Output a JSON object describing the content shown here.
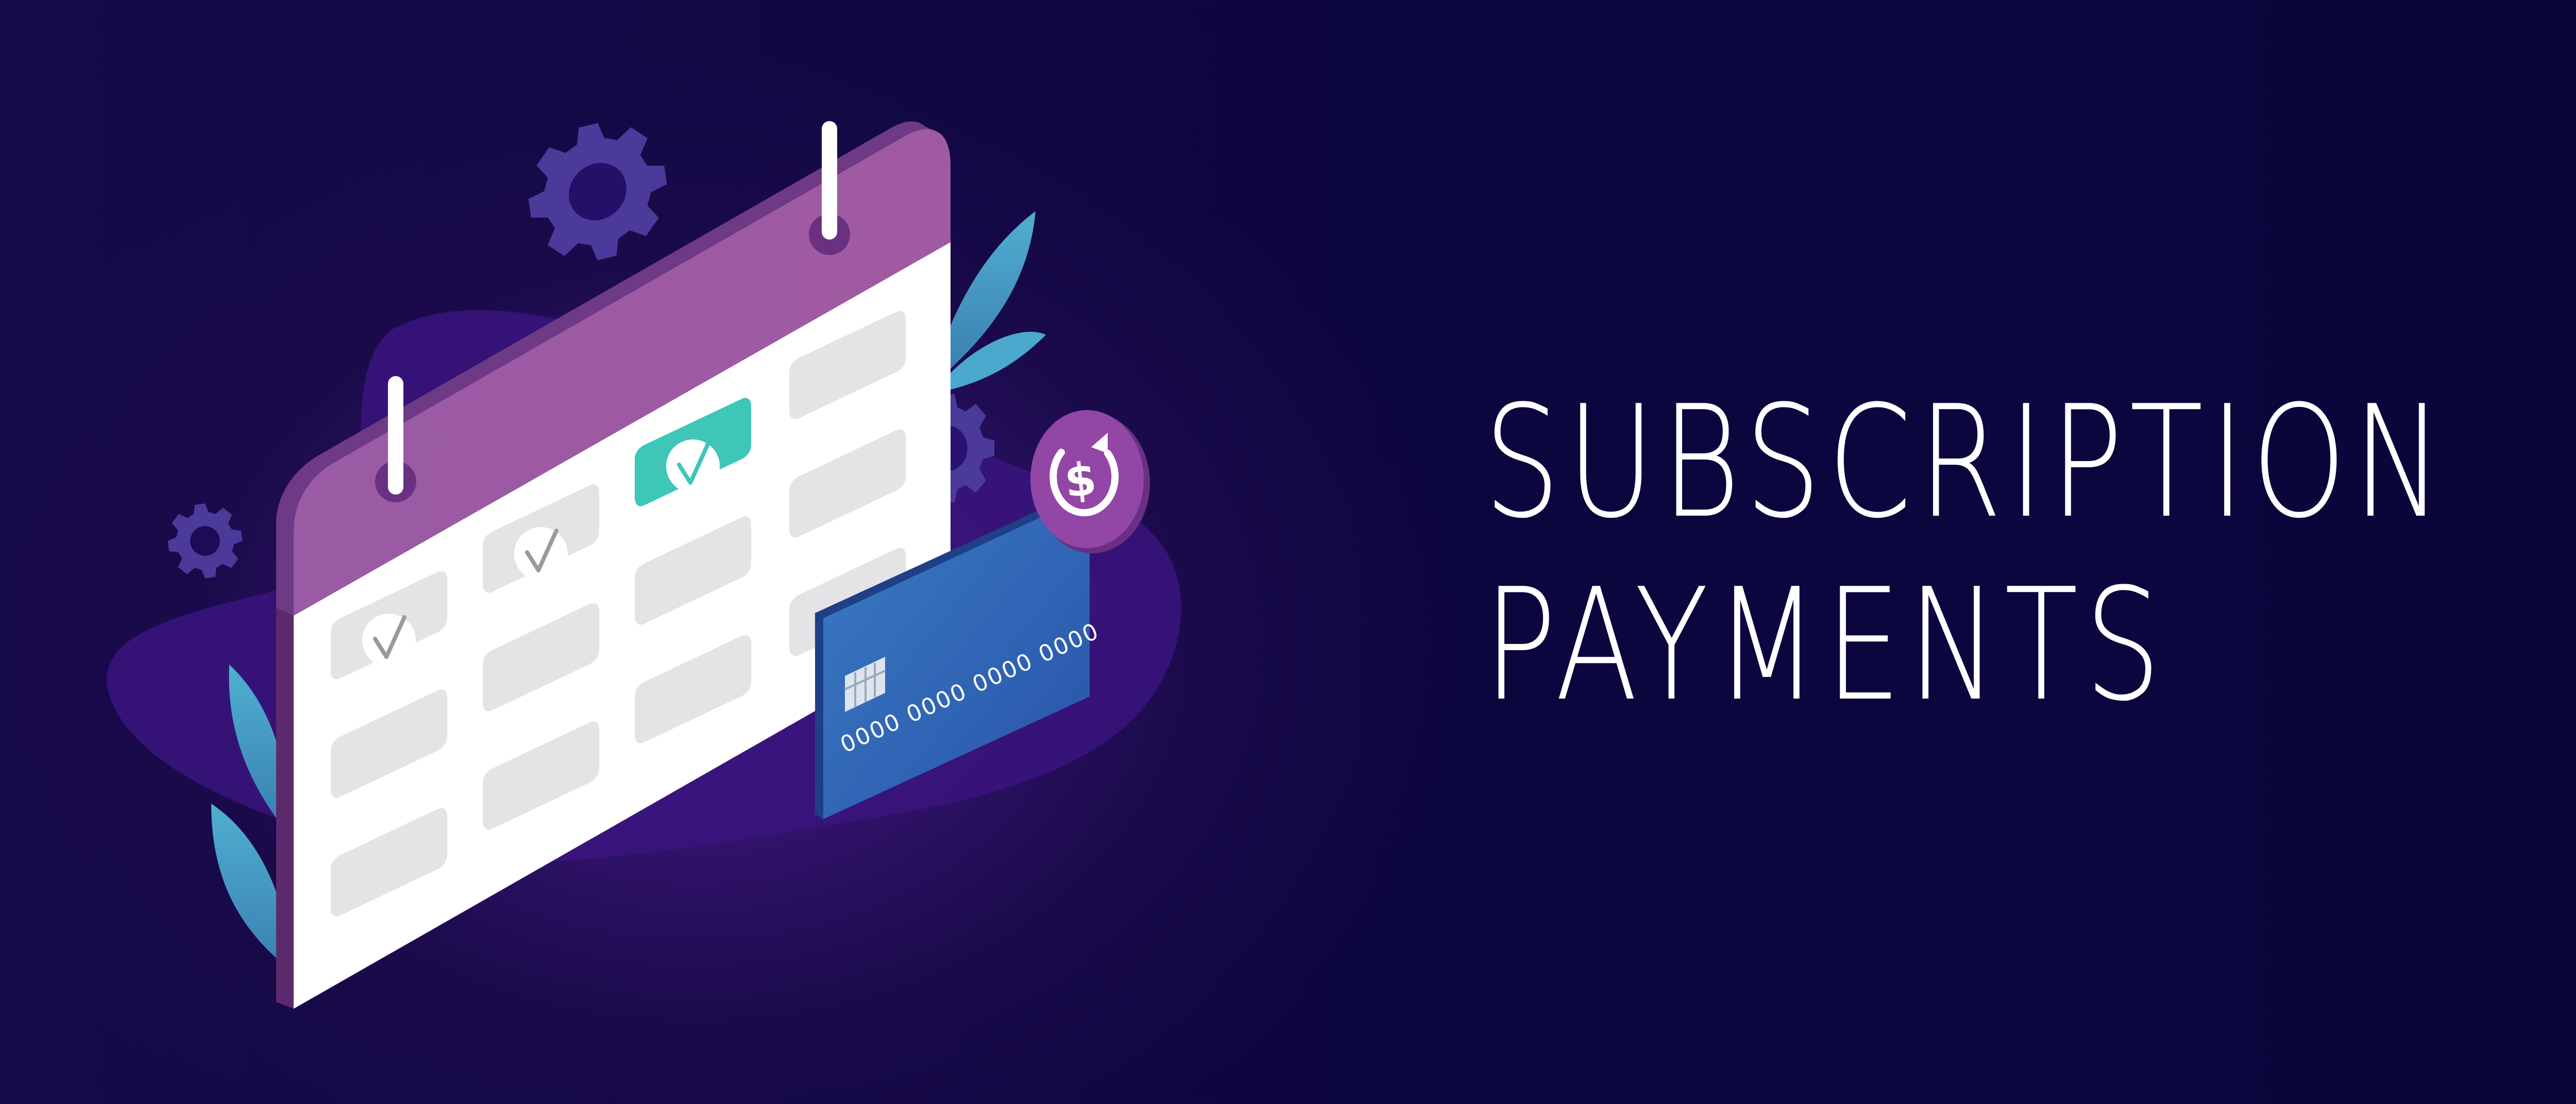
{
  "headline": {
    "line1": "SUBSCRIPTION",
    "line2": "PAYMENTS"
  },
  "card": {
    "number": "0000 0000 0000 0000"
  },
  "icons": {
    "calendar": "calendar-icon",
    "card": "credit-card-icon",
    "recurring": "recurring-payment-icon",
    "gear": "gear-icon",
    "leaf": "leaf-icon",
    "check": "check-mark-icon"
  },
  "colors": {
    "background": "#0c063e",
    "calendar_header": "#9b59a3",
    "calendar_body": "#ffffff",
    "day_cell": "#e6e6e6",
    "day_active": "#3ec6b7",
    "card": "#2a5aa8",
    "badge": "#8a3c9a",
    "gear": "#4b3a9a",
    "leaf": "#4fa6c8"
  }
}
